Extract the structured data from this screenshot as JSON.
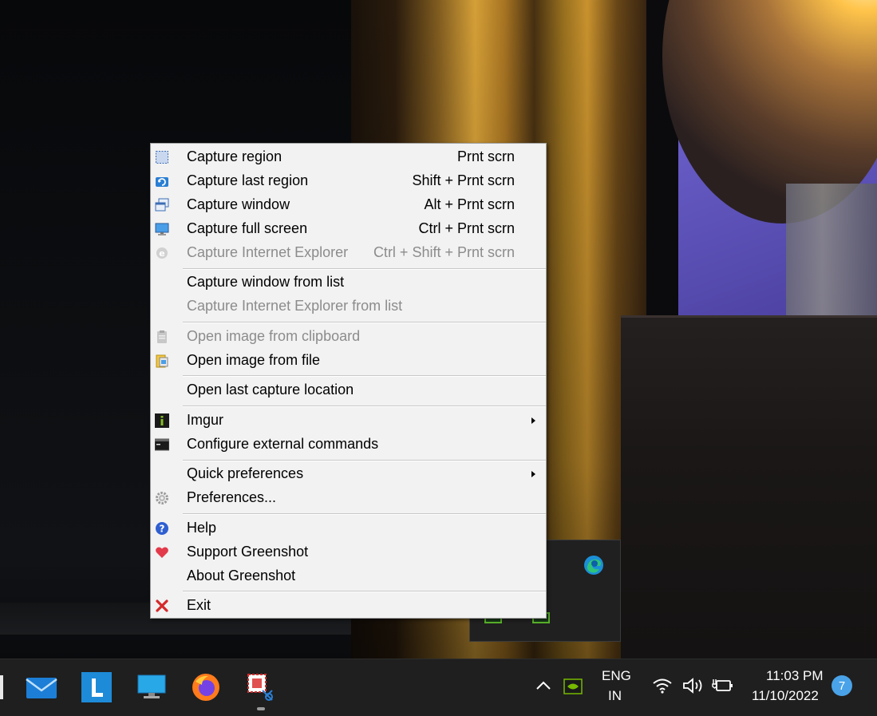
{
  "menu": {
    "items": [
      {
        "label": "Capture region",
        "shortcut": "Prnt scrn",
        "icon": "capture-region-icon",
        "enabled": true
      },
      {
        "label": "Capture last region",
        "shortcut": "Shift + Prnt scrn",
        "icon": "capture-last-region-icon",
        "enabled": true
      },
      {
        "label": "Capture window",
        "shortcut": "Alt + Prnt scrn",
        "icon": "capture-window-icon",
        "enabled": true
      },
      {
        "label": "Capture full screen",
        "shortcut": "Ctrl + Prnt scrn",
        "icon": "monitor-icon",
        "enabled": true
      },
      {
        "label": "Capture Internet Explorer",
        "shortcut": "Ctrl + Shift + Prnt scrn",
        "icon": "internet-explorer-icon",
        "enabled": false
      },
      {
        "label": "Capture window from list",
        "enabled": true
      },
      {
        "label": "Capture Internet Explorer from list",
        "enabled": false
      },
      {
        "label": "Open image from clipboard",
        "icon": "clipboard-icon",
        "enabled": false
      },
      {
        "label": "Open image from file",
        "icon": "open-file-icon",
        "enabled": true
      },
      {
        "label": "Open last capture location",
        "enabled": true
      },
      {
        "label": "Imgur",
        "icon": "imgur-icon",
        "enabled": true,
        "submenu": true
      },
      {
        "label": "Configure external commands",
        "icon": "terminal-icon",
        "enabled": true
      },
      {
        "label": "Quick preferences",
        "enabled": true,
        "submenu": true
      },
      {
        "label": "Preferences...",
        "icon": "gear-icon",
        "enabled": true
      },
      {
        "label": "Help",
        "icon": "help-icon",
        "enabled": true
      },
      {
        "label": "Support Greenshot",
        "icon": "heart-icon",
        "enabled": true
      },
      {
        "label": "About Greenshot",
        "enabled": true
      },
      {
        "label": "Exit",
        "icon": "close-icon",
        "enabled": true
      }
    ]
  },
  "taskbar": {
    "apps": [
      "mail-icon",
      "l-app-icon",
      "remote-desktop-icon",
      "firefox-icon",
      "greenshot-icon"
    ],
    "language": {
      "line1": "ENG",
      "line2": "IN"
    },
    "time": "11:03 PM",
    "date": "11/10/2022",
    "notification_count": "7"
  },
  "colors": {
    "menu_bg": "#f2f2f2",
    "disabled_text": "#8c8c8c",
    "taskbar_bg": "#1f1f1f",
    "badge": "#4aa3e8"
  }
}
